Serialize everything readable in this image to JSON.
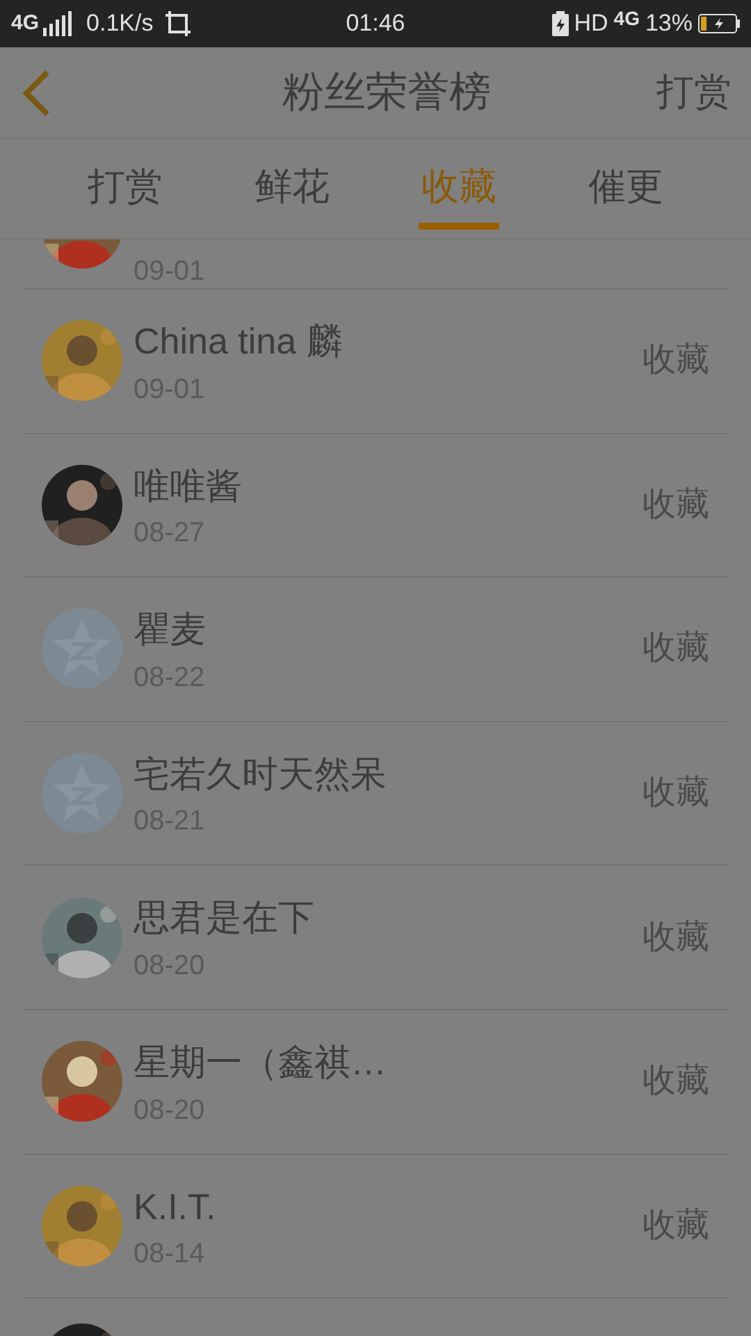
{
  "status_bar": {
    "network": "4G",
    "speed": "0.1K/s",
    "time": "01:46",
    "hd": "HD",
    "network_2": "4G",
    "battery": "13%"
  },
  "header": {
    "title": "粉丝荣誉榜",
    "action": "打赏"
  },
  "tabs": [
    {
      "label": "打赏",
      "selected": false
    },
    {
      "label": "鲜花",
      "selected": false
    },
    {
      "label": "收藏",
      "selected": true
    },
    {
      "label": "催更",
      "selected": false
    }
  ],
  "list": [
    {
      "kind": "partial",
      "date": "09-01"
    },
    {
      "kind": "full",
      "name": "China tina 麟",
      "date": "09-01",
      "action": "收藏"
    },
    {
      "kind": "full",
      "name": "唯唯酱",
      "date": "08-27",
      "action": "收藏"
    },
    {
      "kind": "full",
      "avatar": {
        "kind": "default"
      },
      "name": "瞿麦",
      "date": "08-22",
      "action": "收藏"
    },
    {
      "kind": "full",
      "avatar": {
        "kind": "default"
      },
      "name": "宅若久时天然呆",
      "date": "08-21",
      "action": "收藏"
    },
    {
      "kind": "full",
      "name": "思君是在下",
      "date": "08-20",
      "action": "收藏"
    },
    {
      "kind": "full",
      "name": "星期一（鑫祺…",
      "date": "08-20",
      "action": "收藏"
    },
    {
      "kind": "full",
      "name": "K.I.T.",
      "date": "08-14",
      "action": "收藏"
    },
    {
      "kind": "cut"
    }
  ]
}
